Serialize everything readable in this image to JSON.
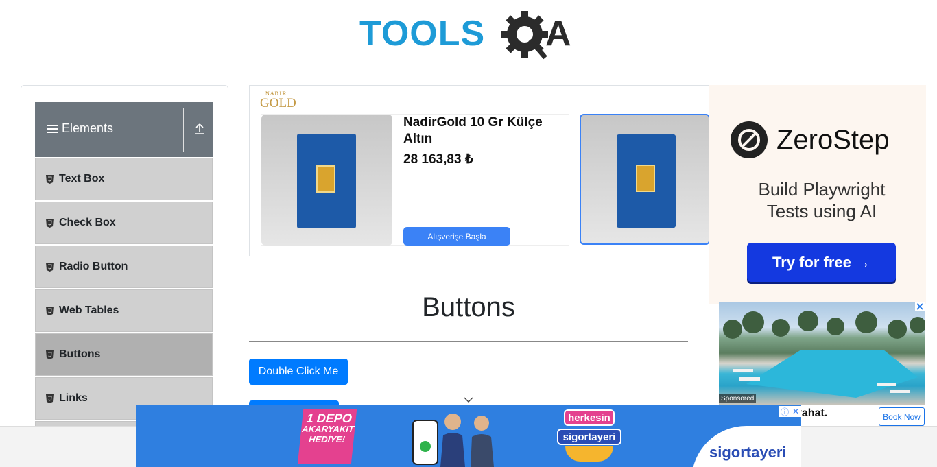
{
  "header": {
    "logo_text": "TOOLSQA"
  },
  "sidebar": {
    "group_title": "Elements",
    "items": [
      {
        "label": "Text Box"
      },
      {
        "label": "Check Box"
      },
      {
        "label": "Radio Button"
      },
      {
        "label": "Web Tables"
      },
      {
        "label": "Buttons",
        "active": true
      },
      {
        "label": "Links"
      }
    ]
  },
  "product_ad": {
    "brand_top": "NADIR",
    "brand_bottom": "GOLD",
    "product_name": "NadirGold 10 Gr Külçe Altın",
    "price": "28 163,83 ₺",
    "cta": "Alışverişe Başla"
  },
  "main": {
    "title": "Buttons",
    "double_click_label": "Double Click Me"
  },
  "right_ad": {
    "brand": "ZeroStep",
    "tagline_line1": "Build Playwright",
    "tagline_line2": "Tests using AI",
    "cta": "Try for free →"
  },
  "hotel_ad": {
    "sponsored": "Sponsored",
    "text_fragment": "yahat.",
    "cta": "Book Now"
  },
  "bottom_ad": {
    "depo_line1": "1 DEPO",
    "depo_line2": "AKARYAKIT",
    "depo_line3": "HEDİYE!",
    "herkesin": "herkesin",
    "sigortayeri_small": "sigortayeri",
    "sigortayeri_logo": "sigortayeri"
  },
  "colors": {
    "primary": "#007bff",
    "sidebar_header": "#6c757d",
    "menu_item": "#d0d0d0",
    "menu_item_active": "#b0b0b0",
    "logo_blue": "#1e9bd7"
  }
}
